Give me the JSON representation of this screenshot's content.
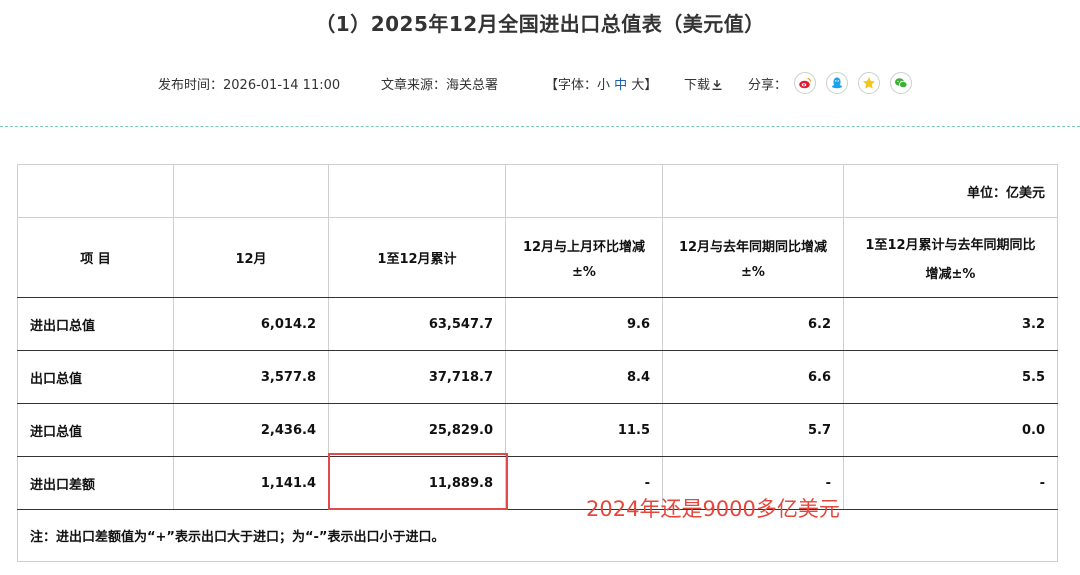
{
  "page": {
    "title": "（1）2025年12月全国进出口总值表（美元值）"
  },
  "meta": {
    "publish_time": "发布时间：2026-01-14 11:00",
    "source": "文章来源：海关总署",
    "font_open": "【字体：",
    "font_small": "小",
    "font_medium": "中",
    "font_large": "大",
    "font_close": "】",
    "download": "下载",
    "share": "分享："
  },
  "share_icons": [
    "weibo-icon",
    "qq-icon",
    "qzone-icon",
    "wechat-icon"
  ],
  "colors": {
    "accent_blue": "#1a5cb5",
    "annotation_red": "#e6473d",
    "divider_green": "#7fc8b4"
  },
  "table": {
    "unit": "单位：亿美元",
    "headers": {
      "item": "项 目",
      "month": "12月",
      "ytd": "1至12月累计",
      "mom_line1": "12月与上月环比增减",
      "mom_line2": "±%",
      "yoy_line1": "12月与去年同期同比增减",
      "yoy_line2": "±%",
      "ytd_yoy_line1": "1至12月累计与去年同期同比",
      "ytd_yoy_line2": "增减±%"
    },
    "rows": [
      {
        "item": "进出口总值",
        "month": "6,014.2",
        "ytd": "63,547.7",
        "mom": "9.6",
        "yoy": "6.2",
        "ytd_yoy": "3.2"
      },
      {
        "item": "出口总值",
        "month": "3,577.8",
        "ytd": "37,718.7",
        "mom": "8.4",
        "yoy": "6.6",
        "ytd_yoy": "5.5"
      },
      {
        "item": "进口总值",
        "month": "2,436.4",
        "ytd": "25,829.0",
        "mom": "11.5",
        "yoy": "5.7",
        "ytd_yoy": "0.0"
      },
      {
        "item": "进出口差额",
        "month": "1,141.4",
        "ytd": "11,889.8",
        "mom": "-",
        "yoy": "-",
        "ytd_yoy": "-"
      }
    ],
    "note": "注：进出口差额值为“+”表示出口大于进口；为“-”表示出口小于进口。"
  },
  "annotation": "2024年还是9000多亿美元"
}
